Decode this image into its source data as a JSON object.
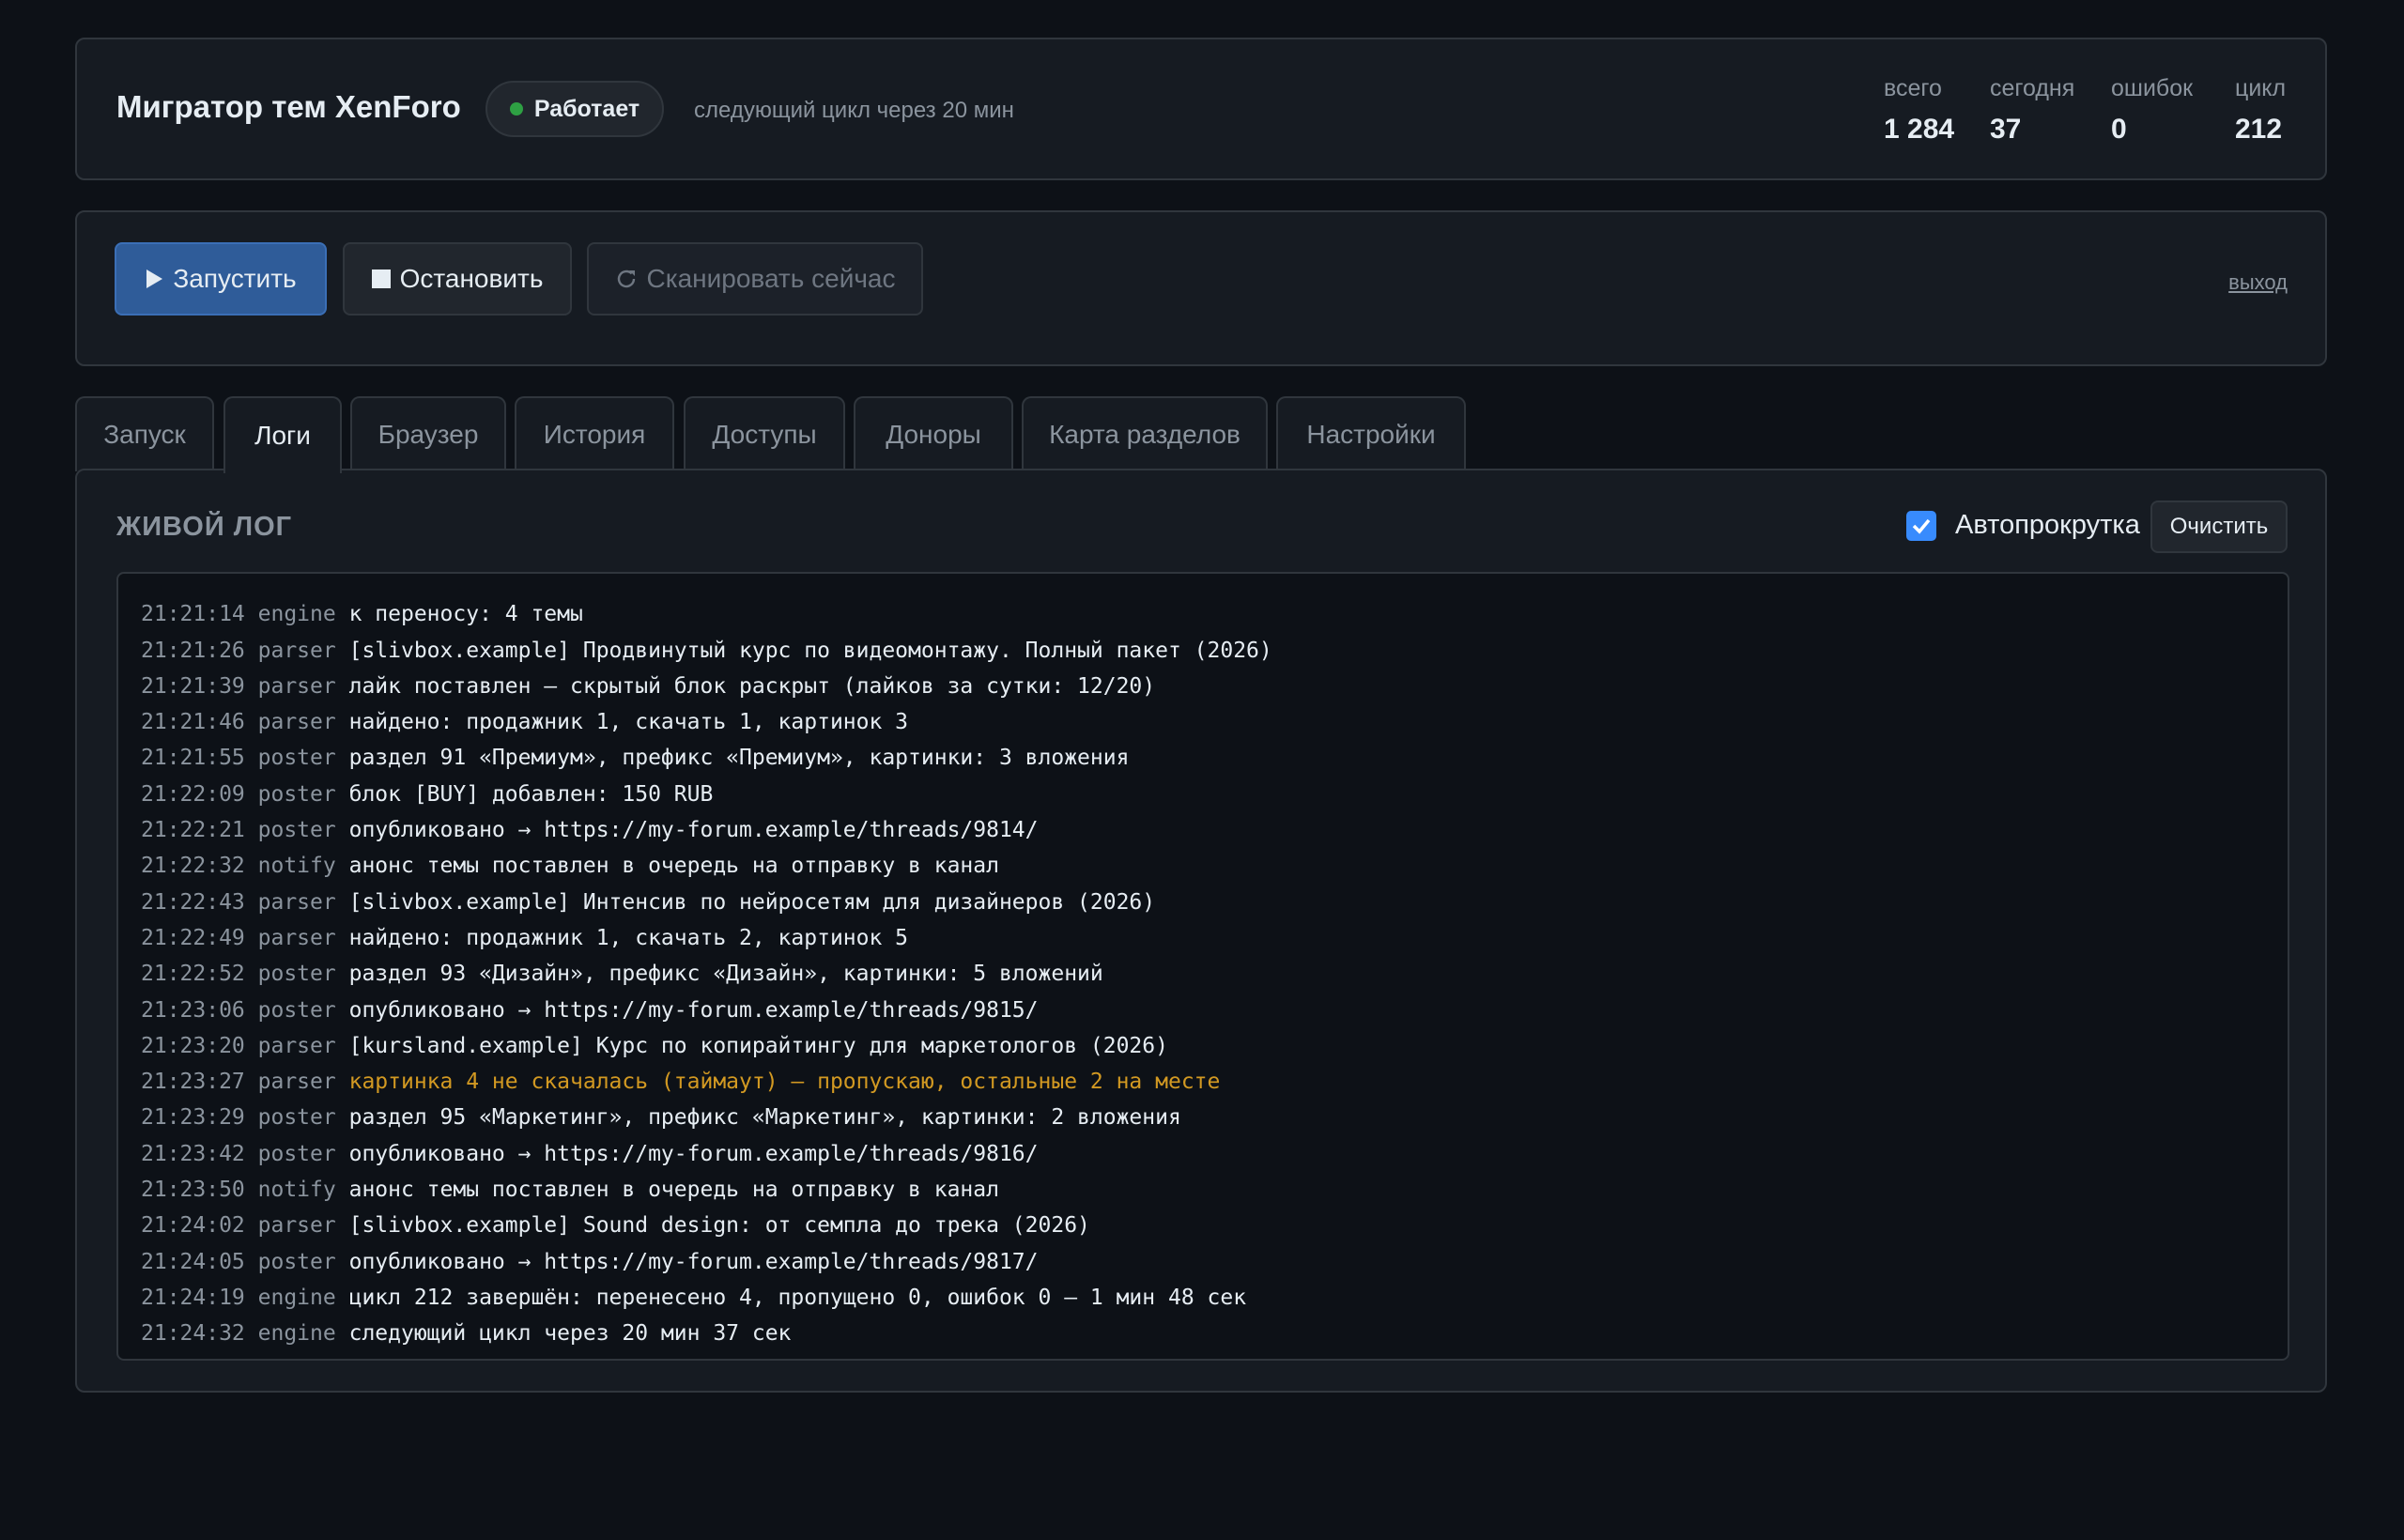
{
  "header": {
    "title": "Мигратор тем XenForo",
    "status": "Работает",
    "next_cycle": "следующий цикл через 20 мин",
    "stats": [
      {
        "label": "всего",
        "value": "1 284"
      },
      {
        "label": "сегодня",
        "value": "37"
      },
      {
        "label": "ошибок",
        "value": "0"
      },
      {
        "label": "цикл",
        "value": "212"
      }
    ]
  },
  "controls": {
    "run_label": "Запустить",
    "stop_label": "Остановить",
    "scan_label": "Сканировать сейчас",
    "logout_label": "выход"
  },
  "tabs": [
    "Запуск",
    "Логи",
    "Браузер",
    "История",
    "Доступы",
    "Доноры",
    "Карта разделов",
    "Настройки"
  ],
  "active_tab": "Логи",
  "log": {
    "heading": "ЖИВОЙ ЛОГ",
    "autoscroll_label": "Автопрокрутка",
    "autoscroll_checked": true,
    "clear_label": "Очистить",
    "lines": [
      {
        "time": "",
        "src": "",
        "msg": "",
        "level": "info"
      },
      {
        "time": "21:21:14",
        "src": "engine",
        "msg": "к переносу: 4 темы",
        "level": "info"
      },
      {
        "time": "21:21:26",
        "src": "parser",
        "msg": "[slivbox.example] Продвинутый курс по видеомонтажу. Полный пакет (2026)",
        "level": "info"
      },
      {
        "time": "21:21:39",
        "src": "parser",
        "msg": "лайк поставлен — скрытый блок раскрыт (лайков за сутки: 12/20)",
        "level": "info"
      },
      {
        "time": "21:21:46",
        "src": "parser",
        "msg": "найдено: продажник 1, скачать 1, картинок 3",
        "level": "info"
      },
      {
        "time": "21:21:55",
        "src": "poster",
        "msg": "раздел 91 «Премиум», префикс «Премиум», картинки: 3 вложения",
        "level": "info"
      },
      {
        "time": "21:22:09",
        "src": "poster",
        "msg": "блок [BUY] добавлен: 150 RUB",
        "level": "info"
      },
      {
        "time": "21:22:21",
        "src": "poster",
        "msg": "опубликовано → https://my-forum.example/threads/9814/",
        "level": "info"
      },
      {
        "time": "21:22:32",
        "src": "notify",
        "msg": "анонс темы поставлен в очередь на отправку в канал",
        "level": "info"
      },
      {
        "time": "21:22:43",
        "src": "parser",
        "msg": "[slivbox.example] Интенсив по нейросетям для дизайнеров (2026)",
        "level": "info"
      },
      {
        "time": "21:22:49",
        "src": "parser",
        "msg": "найдено: продажник 1, скачать 2, картинок 5",
        "level": "info"
      },
      {
        "time": "21:22:52",
        "src": "poster",
        "msg": "раздел 93 «Дизайн», префикс «Дизайн», картинки: 5 вложений",
        "level": "info"
      },
      {
        "time": "21:23:06",
        "src": "poster",
        "msg": "опубликовано → https://my-forum.example/threads/9815/",
        "level": "info"
      },
      {
        "time": "21:23:20",
        "src": "parser",
        "msg": "[kursland.example] Курс по копирайтингу для маркетологов (2026)",
        "level": "info"
      },
      {
        "time": "21:23:27",
        "src": "parser",
        "msg": "картинка 4 не скачалась (таймаут) — пропускаю, остальные 2 на месте",
        "level": "warn"
      },
      {
        "time": "21:23:29",
        "src": "poster",
        "msg": "раздел 95 «Маркетинг», префикс «Маркетинг», картинки: 2 вложения",
        "level": "info"
      },
      {
        "time": "21:23:42",
        "src": "poster",
        "msg": "опубликовано → https://my-forum.example/threads/9816/",
        "level": "info"
      },
      {
        "time": "21:23:50",
        "src": "notify",
        "msg": "анонс темы поставлен в очередь на отправку в канал",
        "level": "info"
      },
      {
        "time": "21:24:02",
        "src": "parser",
        "msg": "[slivbox.example] Sound design: от семпла до трека (2026)",
        "level": "info"
      },
      {
        "time": "21:24:05",
        "src": "poster",
        "msg": "опубликовано → https://my-forum.example/threads/9817/",
        "level": "info"
      },
      {
        "time": "21:24:19",
        "src": "engine",
        "msg": "цикл 212 завершён: перенесено 4, пропущено 0, ошибок 0 — 1 мин 48 сек",
        "level": "info"
      },
      {
        "time": "21:24:32",
        "src": "engine",
        "msg": "следующий цикл через 20 мин 37 сек",
        "level": "info"
      }
    ]
  },
  "colors": {
    "background": "#0d1117",
    "panel": "#161b22",
    "accent": "#2f5c99",
    "status_ok": "#2ea043",
    "warning": "#d29922"
  }
}
